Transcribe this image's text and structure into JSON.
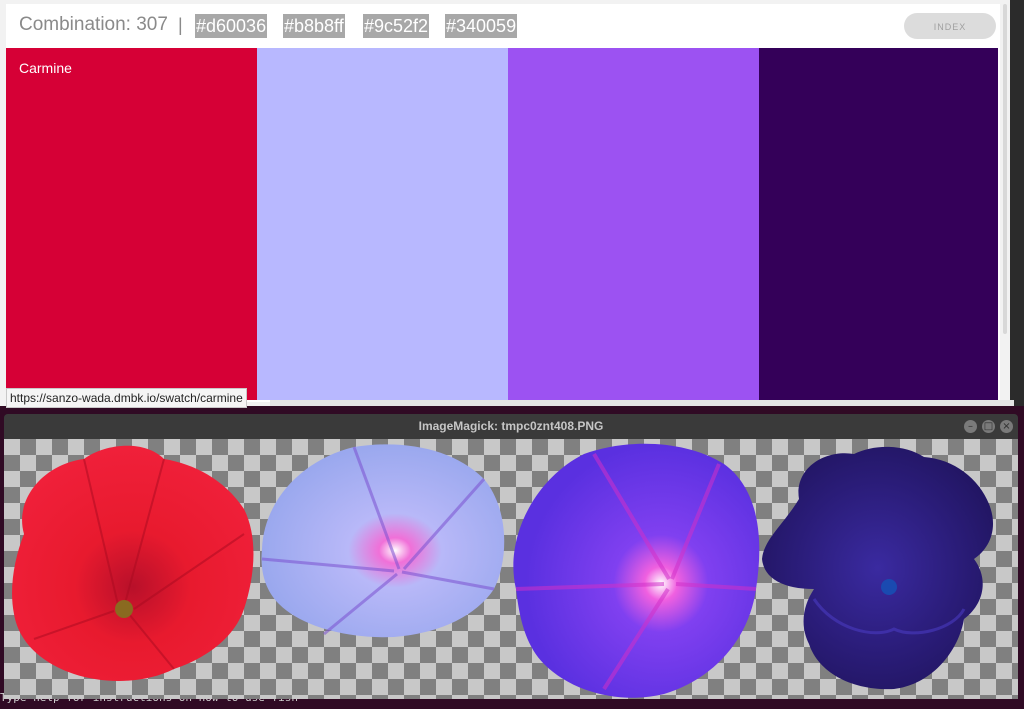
{
  "browser": {
    "combination_label": "Combination: 307",
    "separator": "|",
    "hex_codes": [
      "#d60036",
      "#b8b8ff",
      "#9c52f2",
      "#340059"
    ],
    "index_button": "INDEX",
    "swatch_name": "Carmine",
    "swatch_colors": [
      "#d60036",
      "#b8b8ff",
      "#9c52f2",
      "#340059"
    ],
    "status_url": "https://sanzo-wada.dmbk.io/swatch/carmine"
  },
  "imagemagick": {
    "title": "ImageMagick: tmpc0znt408.PNG",
    "minimize_icon": "minimize-icon",
    "maximize_icon": "maximize-icon",
    "close_icon": "close-icon",
    "flowers": [
      {
        "name": "red-petunia",
        "color": "#e0102a"
      },
      {
        "name": "light-blue-morning-glory",
        "color": "#a9b0f0"
      },
      {
        "name": "purple-morning-glory",
        "color": "#6a3ae8"
      },
      {
        "name": "dark-purple-iris",
        "color": "#2c1e7a"
      }
    ]
  },
  "terminal": {
    "partial_line": "Type help for instructions on how to use fish"
  }
}
